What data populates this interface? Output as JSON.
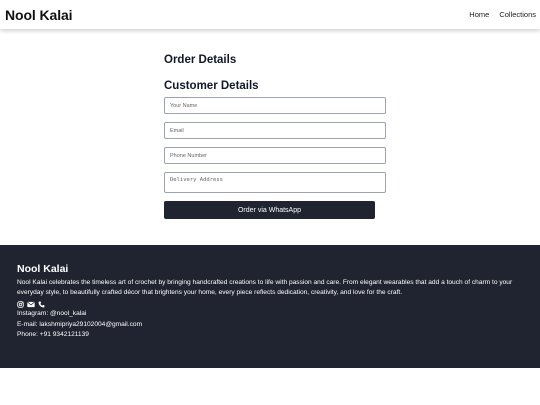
{
  "navbar": {
    "brand": "Nool Kalai",
    "links": [
      "Home",
      "Collections"
    ]
  },
  "main": {
    "order_heading": "Order Details",
    "customer_heading": "Customer Details",
    "fields": {
      "name_placeholder": "Your Name",
      "email_placeholder": "Email",
      "phone_placeholder": "Phone Number",
      "address_placeholder": "Delivery Address"
    },
    "order_button": "Order via WhatsApp"
  },
  "footer": {
    "title": "Nool Kalai",
    "description": "Nool Kalai celebrates the timeless art of crochet by bringing handcrafted creations to life with passion and care. From elegant wearables that add a touch of charm to your everyday style, to beautifully crafted décor that brightens your home, every piece reflects dedication, creativity, and love for the craft.",
    "icons": [
      "instagram-icon",
      "envelope-icon",
      "phone-icon"
    ],
    "instagram": "Instagram: @nool_kalai",
    "email": "E-mail: lakshmipriya29102004@gmail.com",
    "phone": "Phone: +91 9342121139"
  },
  "colors": {
    "footer_bg": "#1f2430",
    "button_bg": "#1f2430",
    "text_dark": "#111827"
  }
}
